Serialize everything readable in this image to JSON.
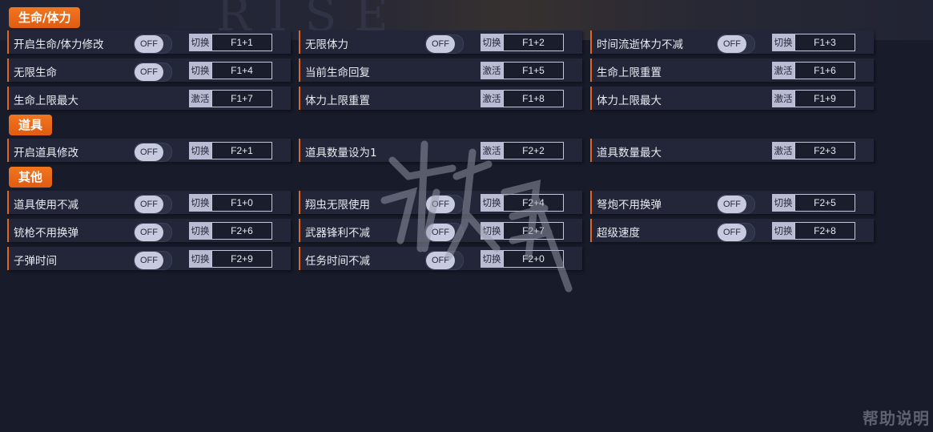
{
  "background_word": "RISE",
  "colors": {
    "accent": "#e0651e",
    "row_bg": "#222638",
    "page_bg": "#181b29"
  },
  "sections": [
    {
      "title": "生命/体力",
      "rows": [
        {
          "label": "开启生命/体力修改",
          "toggle": "OFF",
          "action": "切换",
          "hotkey": "F1+1"
        },
        {
          "label": "无限体力",
          "toggle": "OFF",
          "action": "切换",
          "hotkey": "F1+2"
        },
        {
          "label": "时间流逝体力不减",
          "toggle": "OFF",
          "action": "切换",
          "hotkey": "F1+3"
        },
        {
          "label": "无限生命",
          "toggle": "OFF",
          "action": "切换",
          "hotkey": "F1+4"
        },
        {
          "label": "当前生命回复",
          "toggle": null,
          "action": "激活",
          "hotkey": "F1+5"
        },
        {
          "label": "生命上限重置",
          "toggle": null,
          "action": "激活",
          "hotkey": "F1+6"
        },
        {
          "label": "生命上限最大",
          "toggle": null,
          "action": "激活",
          "hotkey": "F1+7"
        },
        {
          "label": "体力上限重置",
          "toggle": null,
          "action": "激活",
          "hotkey": "F1+8"
        },
        {
          "label": "体力上限最大",
          "toggle": null,
          "action": "激活",
          "hotkey": "F1+9"
        }
      ]
    },
    {
      "title": "道具",
      "rows": [
        {
          "label": "开启道具修改",
          "toggle": "OFF",
          "action": "切换",
          "hotkey": "F2+1"
        },
        {
          "label": "道具数量设为1",
          "toggle": null,
          "action": "激活",
          "hotkey": "F2+2"
        },
        {
          "label": "道具数量最大",
          "toggle": null,
          "action": "激活",
          "hotkey": "F2+3"
        }
      ]
    },
    {
      "title": "其他",
      "rows": [
        {
          "label": "道具使用不减",
          "toggle": "OFF",
          "action": "切换",
          "hotkey": "F1+0"
        },
        {
          "label": "翔虫无限使用",
          "toggle": "OFF",
          "action": "切换",
          "hotkey": "F2+4"
        },
        {
          "label": "弩炮不用换弹",
          "toggle": "OFF",
          "action": "切换",
          "hotkey": "F2+5"
        },
        {
          "label": "铳枪不用换弹",
          "toggle": "OFF",
          "action": "切换",
          "hotkey": "F2+6"
        },
        {
          "label": "武器锋利不减",
          "toggle": "OFF",
          "action": "切换",
          "hotkey": "F2+7"
        },
        {
          "label": "超级速度",
          "toggle": "OFF",
          "action": "切换",
          "hotkey": "F2+8"
        },
        {
          "label": "子弹时间",
          "toggle": "OFF",
          "action": "切换",
          "hotkey": "F2+9"
        },
        {
          "label": "任务时间不减",
          "toggle": "OFF",
          "action": "切换",
          "hotkey": "F2+0"
        }
      ]
    }
  ],
  "help_label": "帮助说明"
}
